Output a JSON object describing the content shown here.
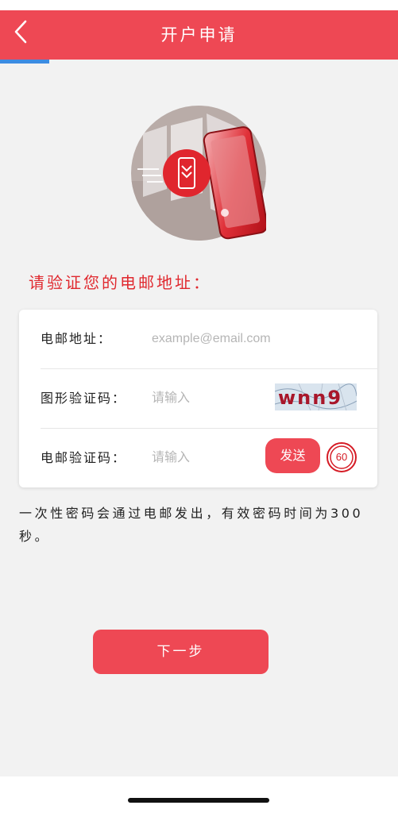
{
  "header": {
    "title": "开户申请",
    "back_icon": "chevron-left-icon"
  },
  "colors": {
    "brand": "#ee4854",
    "accent_red": "#e0282e",
    "progress": "#3c8ce2"
  },
  "progress": {
    "fraction": 0.12
  },
  "prompt": "请验证您的电邮地址：",
  "form": {
    "email": {
      "label": "电邮地址：",
      "placeholder": "example@email.com"
    },
    "captcha": {
      "label": "图形验证码：",
      "placeholder": "请输入",
      "image_text": "wnn9"
    },
    "email_code": {
      "label": "电邮验证码：",
      "placeholder": "请输入",
      "send_label": "发送",
      "countdown": "60"
    }
  },
  "note": "一次性密码会通过电邮发出，有效密码时间为300秒。",
  "next_label": "下一步"
}
